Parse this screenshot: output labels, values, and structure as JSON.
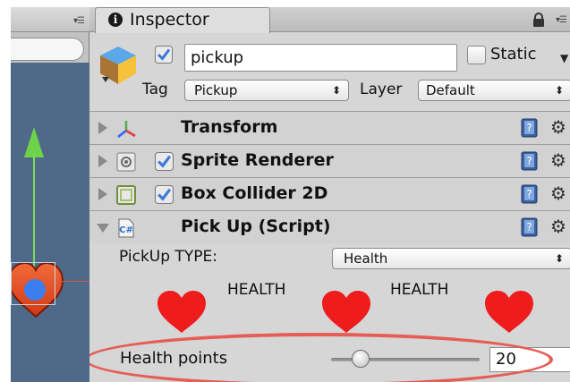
{
  "inspector": {
    "tab_label": "Inspector",
    "object_name": "pickup",
    "active": true,
    "static_label": "Static",
    "static": false,
    "tag_label": "Tag",
    "tag_value": "Pickup",
    "layer_label": "Layer",
    "layer_value": "Default"
  },
  "components": [
    {
      "title": "Transform",
      "expanded": false,
      "has_enable_checkbox": false,
      "icon": "transform-axes-icon"
    },
    {
      "title": "Sprite Renderer",
      "expanded": false,
      "has_enable_checkbox": true,
      "enabled": true,
      "icon": "sprite-renderer-icon"
    },
    {
      "title": "Box Collider 2D",
      "expanded": false,
      "has_enable_checkbox": true,
      "enabled": true,
      "icon": "box-collider-icon"
    },
    {
      "title": "Pick Up (Script)",
      "expanded": true,
      "has_enable_checkbox": false,
      "icon": "csharp-script-icon"
    }
  ],
  "script": {
    "pickup_type_label": "PickUp TYPE:",
    "pickup_type_value": "Health",
    "health_texts": [
      "HEALTH",
      "HEALTH"
    ],
    "health_points_label": "Health points",
    "health_points_value": "20",
    "slider_fraction": 0.2
  },
  "colors": {
    "heart_red": "#ee1c1c",
    "highlight": "#e65d55",
    "scene_bg": "#4f6a88",
    "y_axis": "#6fd24b",
    "checkbox_blue": "#3d78d8"
  }
}
